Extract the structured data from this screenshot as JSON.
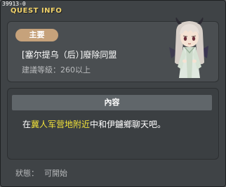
{
  "window": {
    "quest_id": "39913-0",
    "title": "QUEST INFO"
  },
  "header": {
    "category_label": "主要",
    "quest_name": "[塞尔提乌（后）]廢除同盟",
    "level_requirement": "建議等級：260以上"
  },
  "content": {
    "heading": "內容",
    "text_prefix": "在",
    "location": "冀人军营地附近",
    "text_suffix": "中和伊鑢鄉聊天吧。"
  },
  "status": {
    "label": "狀態：",
    "value": "可開始"
  },
  "icons": {
    "npc_portrait": "npc-portrait-icon"
  },
  "colors": {
    "title": "#f0d26a",
    "pill": "#c6a27b",
    "highlight": "#f2e33a"
  }
}
